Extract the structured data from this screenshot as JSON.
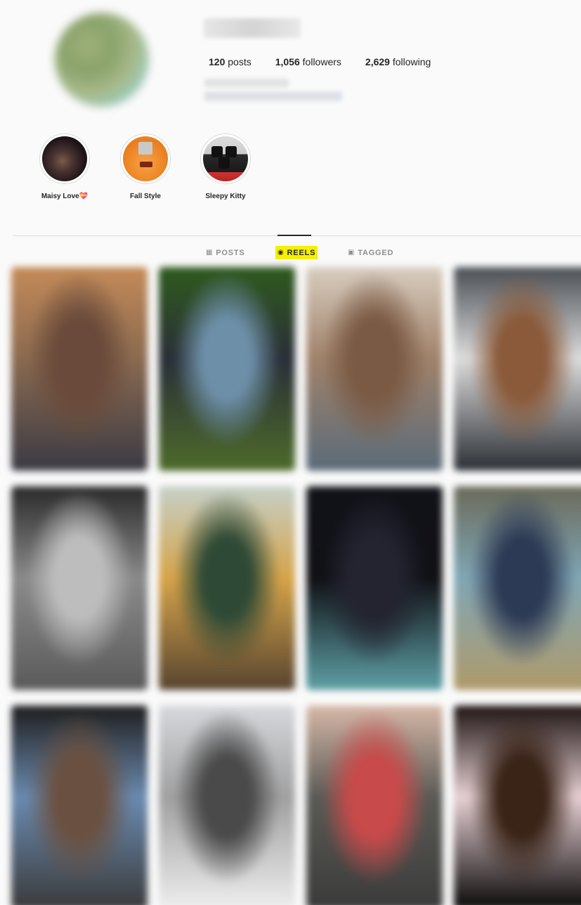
{
  "profile": {
    "stats": [
      {
        "count": "120",
        "label": "posts"
      },
      {
        "count": "1,056",
        "label": "followers"
      },
      {
        "count": "2,629",
        "label": "following"
      }
    ]
  },
  "highlights": [
    {
      "label": "Maisy Love💝",
      "icon": "dog-photo"
    },
    {
      "label": "Fall Style",
      "icon": "pumpkin-photo"
    },
    {
      "label": "Sleepy Kitty",
      "icon": "cats-photo"
    }
  ],
  "tabs": [
    {
      "label": "POSTS",
      "icon": "grid-icon",
      "active": false
    },
    {
      "label": "REELS",
      "icon": "reels-icon",
      "active": true
    },
    {
      "label": "TAGGED",
      "icon": "tagged-icon",
      "active": false
    }
  ],
  "colors": {
    "highlight_marker": "#f4f000",
    "text": "#262626",
    "muted": "#8e8e8e",
    "divider": "#dbdbdb"
  },
  "reels": [
    {
      "palette": [
        "#c48a58",
        "#6a4a3a",
        "#3a3a44",
        "#8a6a50"
      ]
    },
    {
      "palette": [
        "#2f5a1e",
        "#6d8fa8",
        "#4d6b2a",
        "#2a2f38"
      ]
    },
    {
      "palette": [
        "#d8cdbf",
        "#7a5a44",
        "#5a6b7a",
        "#a0826a"
      ]
    },
    {
      "palette": [
        "#4a4f55",
        "#8a5a3a",
        "#2b2f35",
        "#dcdcdc"
      ]
    },
    {
      "palette": [
        "#2a2a2a",
        "#bdbdbd",
        "#5a5a5a",
        "#8a8a8a"
      ]
    },
    {
      "palette": [
        "#c5d0c8",
        "#2e4a36",
        "#56442f",
        "#d6a44a"
      ]
    },
    {
      "palette": [
        "#111218",
        "#232430",
        "#5ea0a6",
        "#101015"
      ]
    },
    {
      "palette": [
        "#6a6a5a",
        "#2d3a55",
        "#b09a6a",
        "#80a6b5"
      ]
    },
    {
      "palette": [
        "#1e1e1e",
        "#6a5040",
        "#3a3a3a",
        "#6a8ab0"
      ]
    },
    {
      "palette": [
        "#d6d8dc",
        "#4a4a4a",
        "#eeeeee",
        "#a0a0a0"
      ]
    },
    {
      "palette": [
        "#d6b8a8",
        "#c84a4a",
        "#3a3a3a",
        "#5a5a55"
      ]
    },
    {
      "palette": [
        "#1e1412",
        "#3a2418",
        "#0a0808",
        "#e6d0d4"
      ]
    }
  ]
}
